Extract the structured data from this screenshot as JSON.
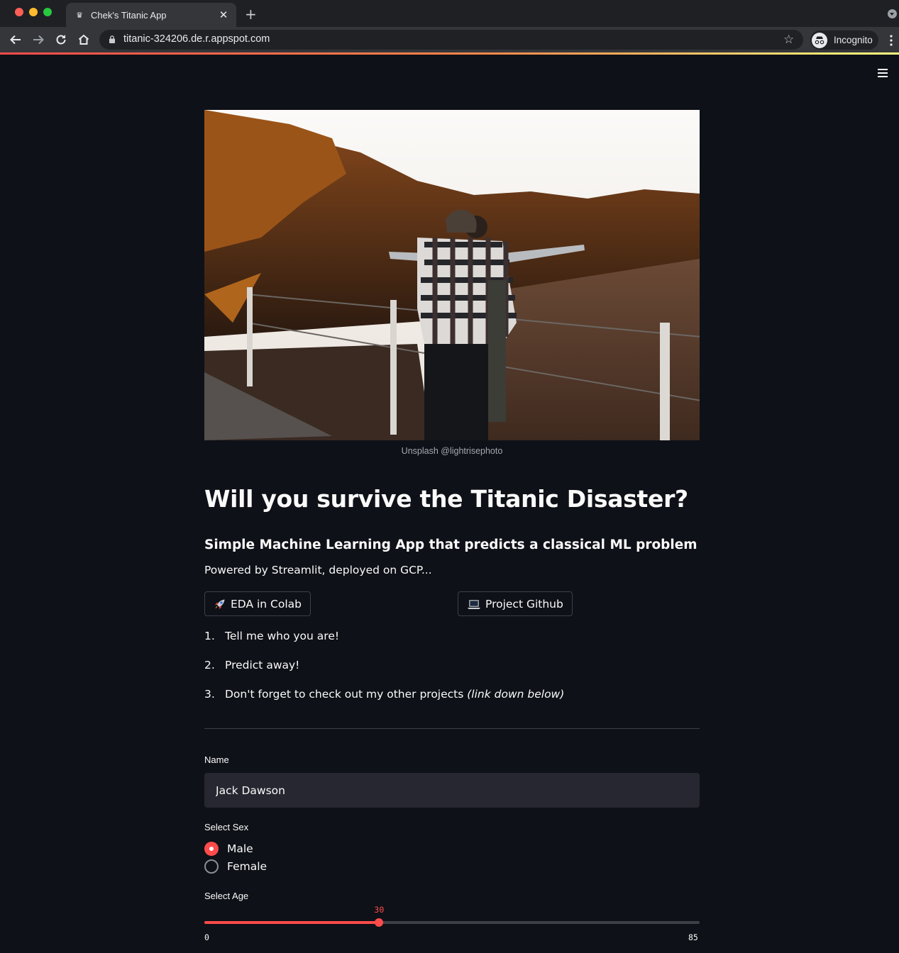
{
  "browser": {
    "tab_title": "Chek's Titanic App",
    "url": "titanic-324206.de.r.appspot.com",
    "profile_label": "Incognito",
    "traffic_colors": [
      "#ff5f57",
      "#febc2e",
      "#28c840"
    ]
  },
  "hero": {
    "caption": "Unsplash @lightrisephoto",
    "alt": "Couple posing like the Titanic scene on a railway overlook at sunset"
  },
  "page": {
    "title": "Will you survive the Titanic Disaster?",
    "subtitle": "Simple Machine Learning App that predicts a classical ML problem",
    "powered_by": "Powered by Streamlit, deployed on GCP...",
    "buttons": {
      "colab": {
        "icon": "rocket-icon",
        "label": "EDA in Colab"
      },
      "github": {
        "icon": "laptop-icon",
        "label": "Project Github"
      }
    },
    "steps": [
      {
        "num": "1.",
        "text": "Tell me who you are!",
        "emphasis": ""
      },
      {
        "num": "2.",
        "text": "Predict away!",
        "emphasis": ""
      },
      {
        "num": "3.",
        "text": "Don't forget to check out my other projects ",
        "emphasis": "(link down below)"
      }
    ]
  },
  "form": {
    "name_label": "Name",
    "name_value": "Jack Dawson",
    "sex_label": "Select Sex",
    "sex_options": [
      "Male",
      "Female"
    ],
    "sex_selected": "Male",
    "age_label": "Select Age",
    "age_min": 0,
    "age_max": 85,
    "age_value": 30
  },
  "colors": {
    "background": "#0e1117",
    "accent": "#ff4b4b",
    "input_bg": "#262730"
  }
}
